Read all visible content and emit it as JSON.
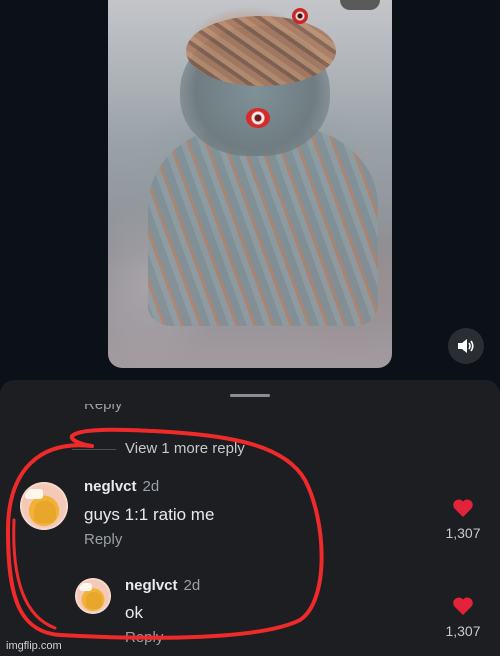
{
  "comments": {
    "cut_reply_label": "Reply",
    "view_more_replies": "View 1 more reply",
    "items": [
      {
        "username": "neglvct",
        "time": "2d",
        "text": "guys 1:1 ratio me",
        "reply_label": "Reply",
        "like_count": "1,307"
      },
      {
        "username": "neglvct",
        "time": "2d",
        "text": "ok",
        "reply_label": "Reply",
        "like_count": "1,307"
      }
    ]
  },
  "icons": {
    "sound": "speaker-icon",
    "like": "heart-icon"
  },
  "colors": {
    "sheet_bg": "#1c1e22",
    "page_bg": "#0c1117",
    "heart": "#e3233a",
    "annotation": "#ef2a2a"
  },
  "watermark": "imgflip.com"
}
